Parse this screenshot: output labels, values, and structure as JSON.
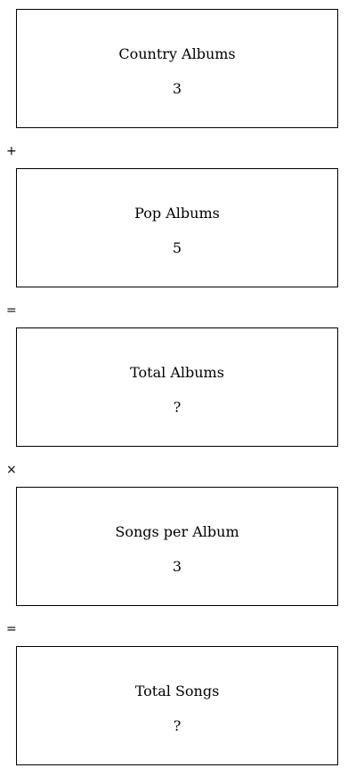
{
  "boxes": [
    {
      "label": "Country Albums",
      "value": "3"
    },
    {
      "label": "Pop Albums",
      "value": "5"
    },
    {
      "label": "Total Albums",
      "value": "?"
    },
    {
      "label": "Songs per Album",
      "value": "3"
    },
    {
      "label": "Total Songs",
      "value": "?"
    }
  ],
  "operators": [
    "+",
    "=",
    "×",
    "="
  ]
}
